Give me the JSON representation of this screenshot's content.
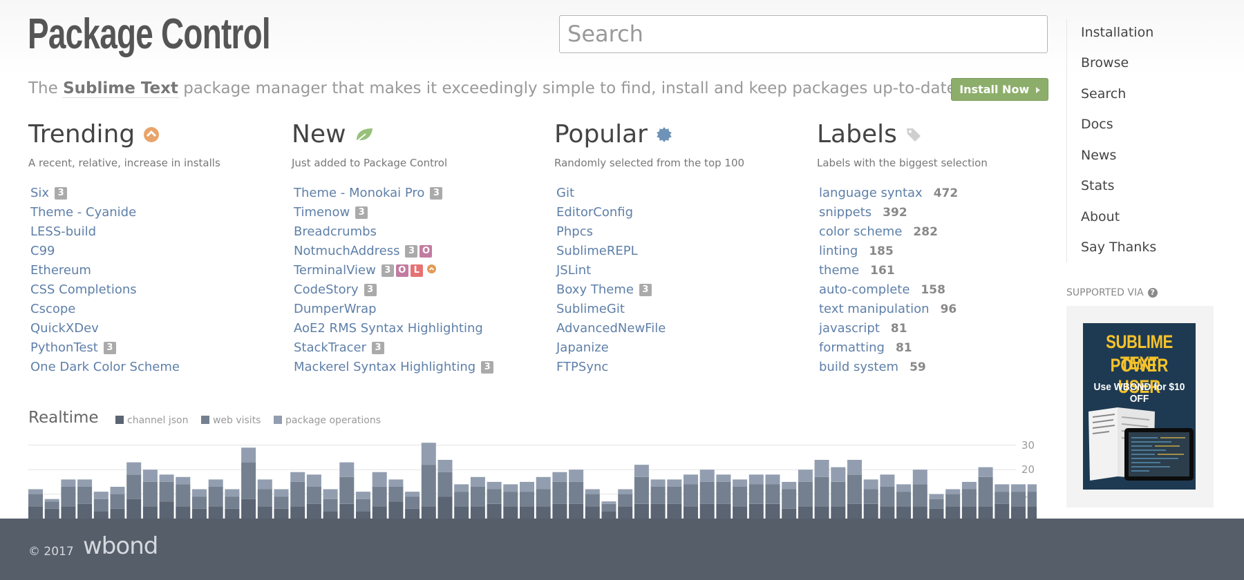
{
  "header": {
    "logo": "Package Control",
    "search_placeholder": "Search",
    "tagline_pre": "The",
    "tagline_highlight": "Sublime Text",
    "tagline_post": "package manager that makes it exceedingly simple to find, install and keep packages up-to-date.",
    "install_button": "Install Now"
  },
  "nav": [
    "Installation",
    "Browse",
    "Search",
    "Docs",
    "News",
    "Stats",
    "About",
    "Say Thanks"
  ],
  "sidebar": {
    "supported_via": "SUPPORTED VIA",
    "ad_line1": "SUBLIME TEXT",
    "ad_line2": "POWER USER",
    "ad_line3": "Use WBOND for $10 OFF"
  },
  "trending": {
    "title": "Trending",
    "subtitle": "A recent, relative, increase in installs",
    "items": [
      {
        "name": "Six",
        "badges": [
          "3"
        ]
      },
      {
        "name": "Theme - Cyanide",
        "badges": []
      },
      {
        "name": "LESS-build",
        "badges": []
      },
      {
        "name": "C99",
        "badges": []
      },
      {
        "name": "Ethereum",
        "badges": []
      },
      {
        "name": "CSS Completions",
        "badges": []
      },
      {
        "name": "Cscope",
        "badges": []
      },
      {
        "name": "QuickXDev",
        "badges": []
      },
      {
        "name": "PythonTest",
        "badges": [
          "3"
        ]
      },
      {
        "name": "One Dark Color Scheme",
        "badges": []
      }
    ]
  },
  "new": {
    "title": "New",
    "subtitle": "Just added to Package Control",
    "items": [
      {
        "name": "Theme - Monokai Pro",
        "badges": [
          "3"
        ]
      },
      {
        "name": "Timenow",
        "badges": [
          "3"
        ]
      },
      {
        "name": "Breadcrumbs",
        "badges": []
      },
      {
        "name": "NotmuchAddress",
        "badges": [
          "3",
          "O"
        ]
      },
      {
        "name": "TerminalView",
        "badges": [
          "3",
          "O",
          "L"
        ],
        "trending": true
      },
      {
        "name": "CodeStory",
        "badges": [
          "3"
        ]
      },
      {
        "name": "DumperWrap",
        "badges": []
      },
      {
        "name": "AoE2 RMS Syntax Highlighting",
        "badges": []
      },
      {
        "name": "StackTracer",
        "badges": [
          "3"
        ]
      },
      {
        "name": "Mackerel Syntax Highlighting",
        "badges": [
          "3"
        ]
      }
    ]
  },
  "popular": {
    "title": "Popular",
    "subtitle": "Randomly selected from the top 100",
    "items": [
      {
        "name": "Git",
        "badges": []
      },
      {
        "name": "EditorConfig",
        "badges": []
      },
      {
        "name": "Phpcs",
        "badges": []
      },
      {
        "name": "SublimeREPL",
        "badges": []
      },
      {
        "name": "JSLint",
        "badges": []
      },
      {
        "name": "Boxy Theme",
        "badges": [
          "3"
        ]
      },
      {
        "name": "SublimeGit",
        "badges": []
      },
      {
        "name": "AdvancedNewFile",
        "badges": []
      },
      {
        "name": "Japanize",
        "badges": []
      },
      {
        "name": "FTPSync",
        "badges": []
      }
    ]
  },
  "labels": {
    "title": "Labels",
    "subtitle": "Labels with the biggest selection",
    "items": [
      {
        "name": "language syntax",
        "count": "472"
      },
      {
        "name": "snippets",
        "count": "392"
      },
      {
        "name": "color scheme",
        "count": "282"
      },
      {
        "name": "linting",
        "count": "185"
      },
      {
        "name": "theme",
        "count": "161"
      },
      {
        "name": "auto-complete",
        "count": "158"
      },
      {
        "name": "text manipulation",
        "count": "96"
      },
      {
        "name": "javascript",
        "count": "81"
      },
      {
        "name": "formatting",
        "count": "81"
      },
      {
        "name": "build system",
        "count": "59"
      }
    ]
  },
  "realtime": {
    "title": "Realtime",
    "legend": [
      {
        "label": "channel json",
        "color": "#5b6472"
      },
      {
        "label": "web visits",
        "color": "#74808f"
      },
      {
        "label": "package operations",
        "color": "#929eb0"
      }
    ]
  },
  "chart_data": {
    "type": "bar",
    "stacked": true,
    "ylim": [
      0,
      37
    ],
    "yticks": [
      "10",
      "20",
      "30"
    ],
    "grid": true,
    "series": [
      {
        "name": "channel json",
        "values": [
          5,
          4,
          5,
          6,
          3,
          4,
          8,
          5,
          7,
          5,
          4,
          5,
          4,
          8,
          5,
          4,
          5,
          6,
          3,
          6,
          3,
          5,
          7,
          4,
          5,
          9,
          5,
          5,
          6,
          5,
          5,
          5,
          6,
          6,
          5,
          3,
          5,
          6,
          6,
          6,
          5,
          6,
          6,
          5,
          6,
          6,
          4,
          5,
          5,
          5,
          6,
          6,
          5,
          5,
          5,
          4,
          5,
          5,
          5,
          6,
          5,
          5,
          6,
          5,
          4
        ]
      },
      {
        "name": "web visits",
        "values": [
          5,
          3,
          8,
          7,
          5,
          6,
          10,
          10,
          8,
          9,
          5,
          8,
          5,
          15,
          7,
          5,
          10,
          7,
          5,
          11,
          5,
          8,
          6,
          5,
          17,
          10,
          6,
          8,
          6,
          6,
          6,
          7,
          9,
          9,
          5,
          3,
          5,
          11,
          7,
          7,
          9,
          9,
          9,
          8,
          8,
          8,
          8,
          10,
          12,
          10,
          12,
          6,
          8,
          6,
          9,
          4,
          5,
          7,
          12,
          5,
          6,
          6,
          6,
          5,
          4
        ]
      },
      {
        "name": "package operations",
        "values": [
          2,
          1,
          3,
          3,
          3,
          3,
          5,
          5,
          3,
          3,
          3,
          3,
          3,
          6,
          4,
          3,
          4,
          5,
          4,
          6,
          3,
          6,
          3,
          2,
          9,
          5,
          3,
          4,
          3,
          3,
          4,
          5,
          4,
          5,
          2,
          1,
          2,
          5,
          3,
          3,
          4,
          5,
          3,
          3,
          4,
          4,
          3,
          5,
          7,
          6,
          6,
          4,
          5,
          3,
          6,
          2,
          2,
          3,
          4,
          3,
          3,
          3,
          3,
          3,
          3
        ]
      }
    ]
  },
  "footer": {
    "copyright": "© 2017",
    "brand": "wbond"
  }
}
